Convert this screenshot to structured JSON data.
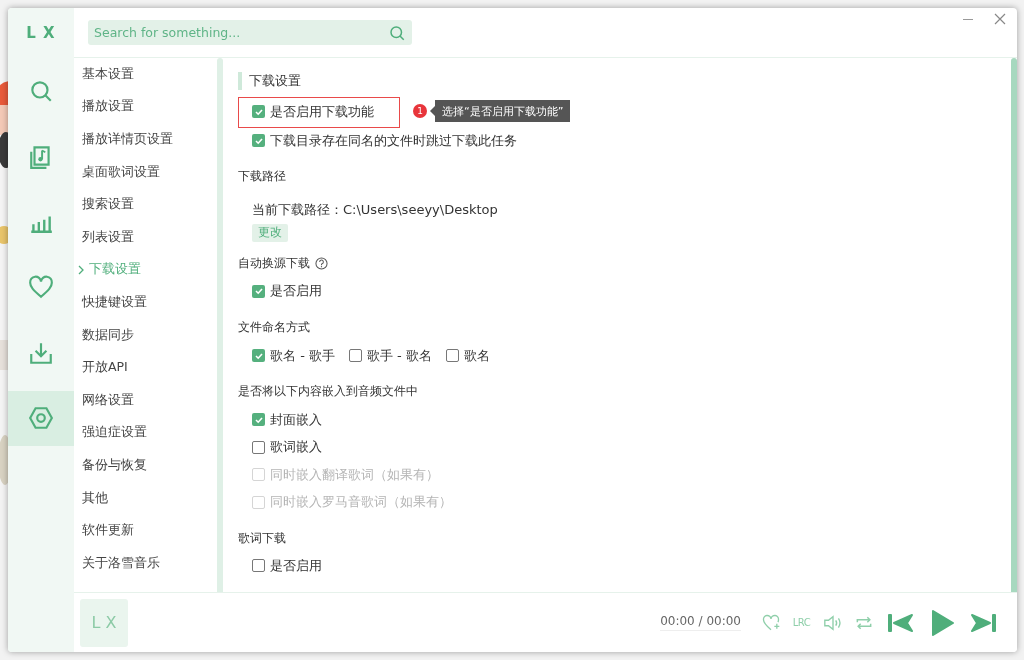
{
  "window": {
    "logo": "L X",
    "search": {
      "placeholder": "Search for something..."
    }
  },
  "nav": [
    {
      "kind": "search",
      "selected": false
    },
    {
      "kind": "music",
      "selected": false
    },
    {
      "kind": "chart",
      "selected": false
    },
    {
      "kind": "heart",
      "selected": false
    },
    {
      "kind": "download",
      "selected": false
    },
    {
      "kind": "settings",
      "selected": true
    }
  ],
  "settings_menu": [
    {
      "label": "基本设置",
      "selected": false
    },
    {
      "label": "播放设置",
      "selected": false
    },
    {
      "label": "播放详情页设置",
      "selected": false
    },
    {
      "label": "桌面歌词设置",
      "selected": false
    },
    {
      "label": "搜索设置",
      "selected": false
    },
    {
      "label": "列表设置",
      "selected": false
    },
    {
      "label": "下载设置",
      "selected": true
    },
    {
      "label": "快捷键设置",
      "selected": false
    },
    {
      "label": "数据同步",
      "selected": false
    },
    {
      "label": "开放API",
      "selected": false
    },
    {
      "label": "网络设置",
      "selected": false
    },
    {
      "label": "强迫症设置",
      "selected": false
    },
    {
      "label": "备份与恢复",
      "selected": false
    },
    {
      "label": "其他",
      "selected": false
    },
    {
      "label": "软件更新",
      "selected": false
    },
    {
      "label": "关于洛雪音乐",
      "selected": false
    }
  ],
  "sections": [
    {
      "kind": "heading",
      "title": "下载设置",
      "items": [
        {
          "kind": "checkbox",
          "label": "是否启用下载功能",
          "checked": true,
          "disabled": false,
          "highlighted": true,
          "annotation": {
            "badge": "1",
            "text": "选择“是否启用下载功能”"
          }
        },
        {
          "kind": "checkbox",
          "label": "下载目录存在同名的文件时跳过下载此任务",
          "checked": true,
          "disabled": false,
          "highlighted": false
        }
      ]
    },
    {
      "kind": "group",
      "title": "下载路径",
      "items": [
        {
          "kind": "path",
          "text": "当前下载路径：C:\\Users\\seeyy\\Desktop",
          "button": "更改"
        }
      ]
    },
    {
      "kind": "group",
      "title": "自动换源下载",
      "help": true,
      "items": [
        {
          "kind": "checkbox",
          "label": "是否启用",
          "checked": true,
          "disabled": false,
          "highlighted": false
        }
      ]
    },
    {
      "kind": "inline",
      "title": "文件命名方式",
      "items": [
        {
          "kind": "checkbox",
          "label": "歌名 - 歌手",
          "checked": true,
          "disabled": false,
          "highlighted": false
        },
        {
          "kind": "checkbox",
          "label": "歌手 - 歌名",
          "checked": false,
          "disabled": false,
          "highlighted": false
        },
        {
          "kind": "checkbox",
          "label": "歌名",
          "checked": false,
          "disabled": false,
          "highlighted": false
        }
      ]
    },
    {
      "kind": "group",
      "title": "是否将以下内容嵌入到音频文件中",
      "items": [
        {
          "kind": "checkbox",
          "label": "封面嵌入",
          "checked": true,
          "disabled": false,
          "highlighted": false
        },
        {
          "kind": "checkbox",
          "label": "歌词嵌入",
          "checked": false,
          "disabled": false,
          "highlighted": false
        },
        {
          "kind": "checkbox",
          "label": "同时嵌入翻译歌词（如果有）",
          "checked": false,
          "disabled": true,
          "highlighted": false
        },
        {
          "kind": "checkbox",
          "label": "同时嵌入罗马音歌词（如果有）",
          "checked": false,
          "disabled": true,
          "highlighted": false
        }
      ]
    },
    {
      "kind": "group",
      "title": "歌词下载",
      "items": [
        {
          "kind": "checkbox",
          "label": "是否启用",
          "checked": false,
          "disabled": false,
          "highlighted": false
        }
      ]
    }
  ],
  "player": {
    "logo": "L X",
    "time": "00:00 / 00:00",
    "lyrics_button": "LRC"
  }
}
